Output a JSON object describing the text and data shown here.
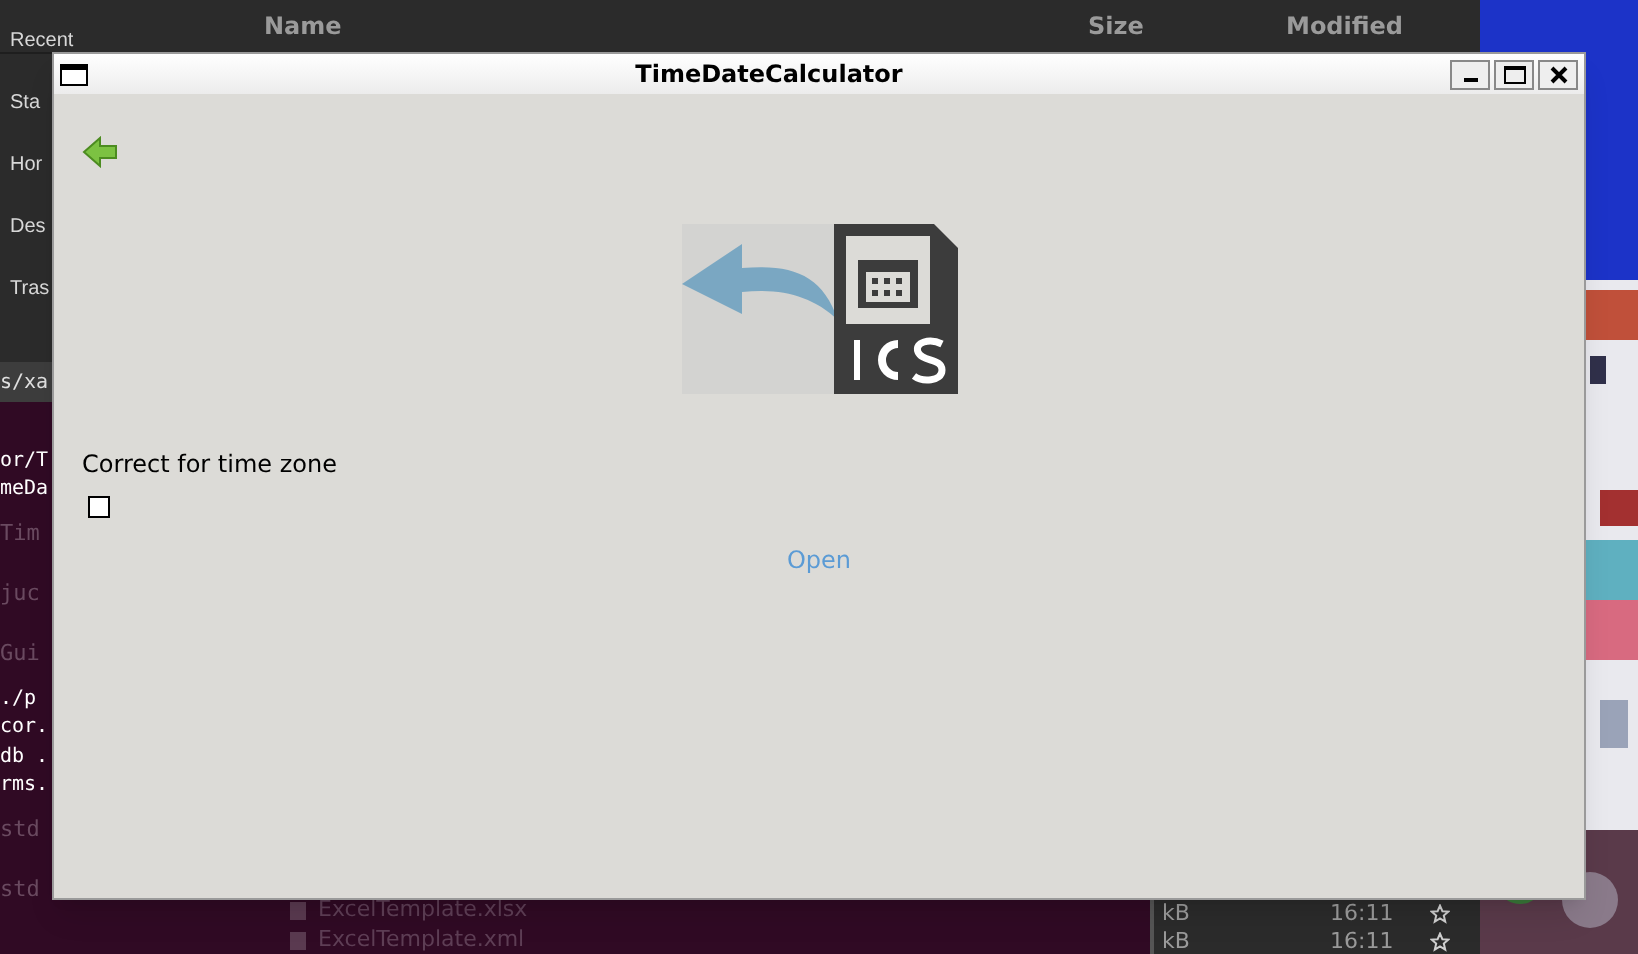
{
  "file_manager": {
    "columns": [
      "Name",
      "Size",
      "Modified"
    ],
    "sidebar_items": [
      "Recent",
      "Sta",
      "Hor",
      "Des",
      "Tras"
    ],
    "files": [
      {
        "name": "ExcelTemplate.xlsx",
        "size": "kB",
        "modified": "16:11",
        "starred": false
      },
      {
        "name": "ExcelTemplate.xml",
        "size": "kB",
        "modified": "16:11",
        "starred": false
      }
    ]
  },
  "terminal": {
    "tab_title": "s/xa",
    "lines": [
      {
        "text": "or/T",
        "kind": "command"
      },
      {
        "text": "meDa",
        "kind": "command"
      },
      {
        "text": "Tim",
        "kind": "dim"
      },
      {
        "text": "juc",
        "kind": "dim"
      },
      {
        "text": "Gui",
        "kind": "dim"
      },
      {
        "text": "./p",
        "kind": "command"
      },
      {
        "text": "cor.",
        "kind": "command"
      },
      {
        "text": "db .",
        "kind": "command"
      },
      {
        "text": "rms.",
        "kind": "command"
      },
      {
        "text": "std",
        "kind": "dim"
      },
      {
        "text": "std",
        "kind": "dim"
      }
    ]
  },
  "window": {
    "title": "TimeDateCalculator",
    "checkbox": {
      "label": "Correct for time zone",
      "checked": false
    },
    "open_link": "Open"
  }
}
